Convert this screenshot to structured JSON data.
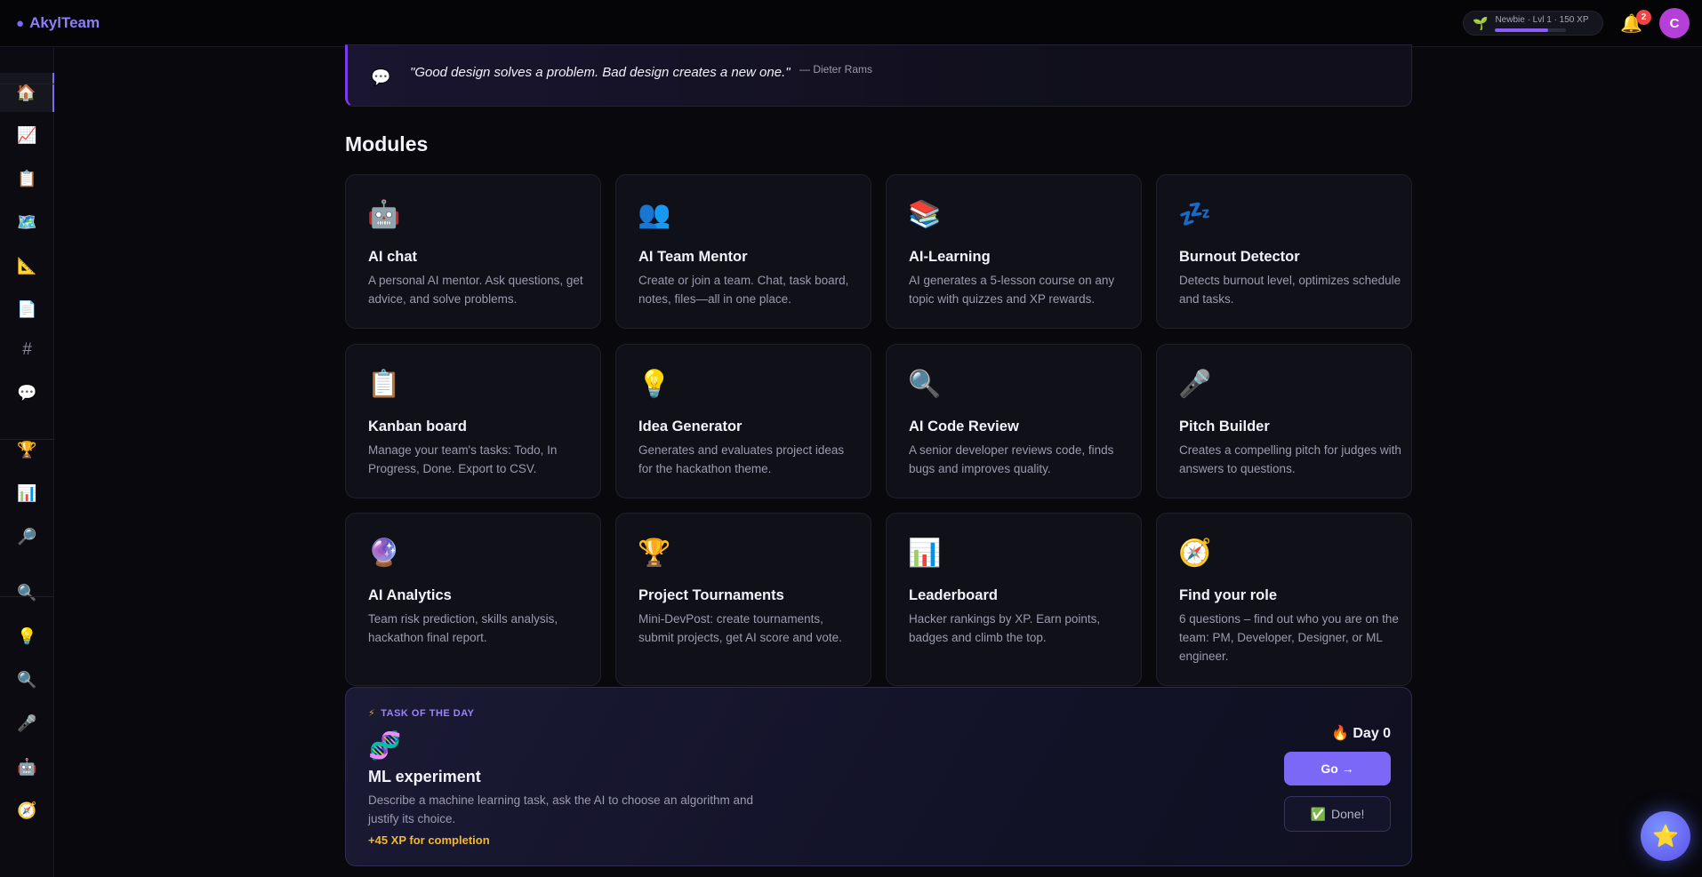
{
  "app": {
    "name": "AkylTeam",
    "logo_icon": "speech-bubble-icon"
  },
  "header": {
    "xp_text": "Newbie · Lvl 1 · 150 XP",
    "xp_progress": 0.75,
    "notifications_count": "2",
    "avatar_letter": "C"
  },
  "sidebar": {
    "items": [
      {
        "icon": "🏠",
        "name": "home-icon",
        "active": true
      },
      {
        "icon": "📈",
        "name": "chart-icon"
      },
      {
        "icon": "📋",
        "name": "clipboard-icon"
      },
      {
        "icon": "🗺️",
        "name": "map-icon"
      },
      {
        "icon": "📐",
        "name": "ruler-icon"
      },
      {
        "icon": "📄",
        "name": "document-icon"
      },
      {
        "icon": "#",
        "name": "hashtag-icon"
      },
      {
        "icon": "💬",
        "name": "chat-icon"
      },
      {
        "icon": "🏆",
        "name": "trophy-icon"
      },
      {
        "icon": "📊",
        "name": "bar-chart-icon"
      },
      {
        "icon": "🔎",
        "name": "search-right-icon"
      },
      {
        "icon": "🔍",
        "name": "search-icon"
      },
      {
        "icon": "💡",
        "name": "lightbulb-icon"
      },
      {
        "icon": "🔍",
        "name": "magnifier-icon"
      },
      {
        "icon": "🎤",
        "name": "microphone-icon"
      },
      {
        "icon": "🤖",
        "name": "robot-icon"
      },
      {
        "icon": "🧭",
        "name": "compass-icon"
      }
    ]
  },
  "quote": {
    "icon": "💬",
    "text": "\"Good design solves a problem. Bad design creates a new one.\"",
    "author": "— Dieter Rams"
  },
  "modules": {
    "title": "Modules",
    "cards": [
      {
        "icon": "🤖",
        "icon_name": "robot-icon",
        "title": "AI chat",
        "desc": "A personal AI mentor. Ask questions, get advice, and solve problems."
      },
      {
        "icon": "👥",
        "icon_name": "team-icon",
        "title": "AI Team Mentor",
        "desc": "Create or join a team. Chat, task board, notes, files—all in one place."
      },
      {
        "icon": "📚",
        "icon_name": "books-icon",
        "title": "AI-Learning",
        "desc": "AI generates a 5-lesson course on any topic with quizzes and XP rewards."
      },
      {
        "icon": "💤",
        "icon_name": "sleep-icon",
        "title": "Burnout Detector",
        "desc": "Detects burnout level, optimizes schedule and tasks."
      },
      {
        "icon": "📋",
        "icon_name": "clipboard-icon",
        "title": "Kanban board",
        "desc": "Manage your team's tasks: Todo, In Progress, Done. Export to CSV."
      },
      {
        "icon": "💡",
        "icon_name": "lightbulb-icon",
        "title": "Idea Generator",
        "desc": "Generates and evaluates project ideas for the hackathon theme."
      },
      {
        "icon": "🔍",
        "icon_name": "magnifier-icon",
        "title": "AI Code Review",
        "desc": "A senior developer reviews code, finds bugs and improves quality."
      },
      {
        "icon": "🎤",
        "icon_name": "microphone-icon",
        "title": "Pitch Builder",
        "desc": "Creates a compelling pitch for judges with answers to questions."
      },
      {
        "icon": "🔮",
        "icon_name": "crystal-ball-icon",
        "title": "AI Analytics",
        "desc": "Team risk prediction, skills analysis, hackathon final report."
      },
      {
        "icon": "🏆",
        "icon_name": "trophy-icon",
        "title": "Project Tournaments",
        "desc": "Mini-DevPost: create tournaments, submit projects, get AI score and vote."
      },
      {
        "icon": "📊",
        "icon_name": "bar-chart-icon",
        "title": "Leaderboard",
        "desc": "Hacker rankings by XP. Earn points, badges and climb the top."
      },
      {
        "icon": "🧭",
        "icon_name": "compass-icon",
        "title": "Find your role",
        "desc": "6 questions – find out who you are on the team: PM, Developer, Designer, or ML engineer."
      }
    ]
  },
  "task": {
    "label_icon": "⚡",
    "label": "TASK OF THE DAY",
    "icon": "🧬",
    "title": "ML experiment",
    "desc": "Describe a machine learning task, ask the AI to choose an algorithm and justify its choice.",
    "xp": "+45 XP for completion",
    "day_icon": "🔥",
    "day": "Day 0",
    "go_label": "Go →",
    "done_icon": "✅",
    "done_label": "Done!"
  },
  "fab": {
    "icon": "⭐"
  }
}
